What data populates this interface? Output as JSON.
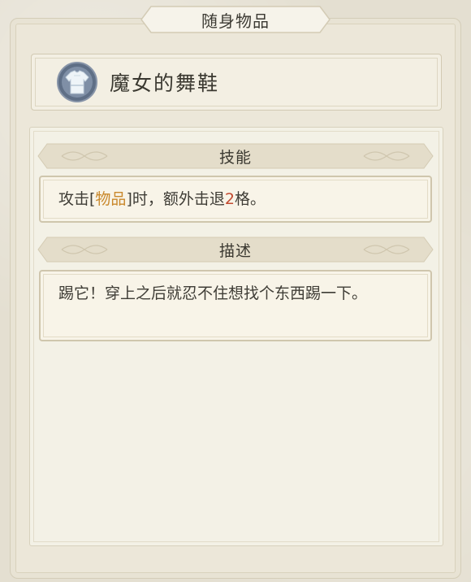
{
  "window": {
    "title": "随身物品"
  },
  "item": {
    "name": "魔女的舞鞋",
    "icon": "shirt-icon"
  },
  "skill": {
    "header": "技能",
    "text_prefix": "攻击[",
    "text_item": "物品",
    "text_mid": "]时，额外击退",
    "text_number": "2",
    "text_suffix": "格。"
  },
  "description": {
    "header": "描述",
    "text": "踢它！穿上之后就忍不住想找个东西踢一下。"
  },
  "colors": {
    "item_highlight": "#c9882b",
    "number_highlight": "#c24a2f",
    "text": "#3f3d36",
    "panel_bg": "#ece7d9"
  }
}
